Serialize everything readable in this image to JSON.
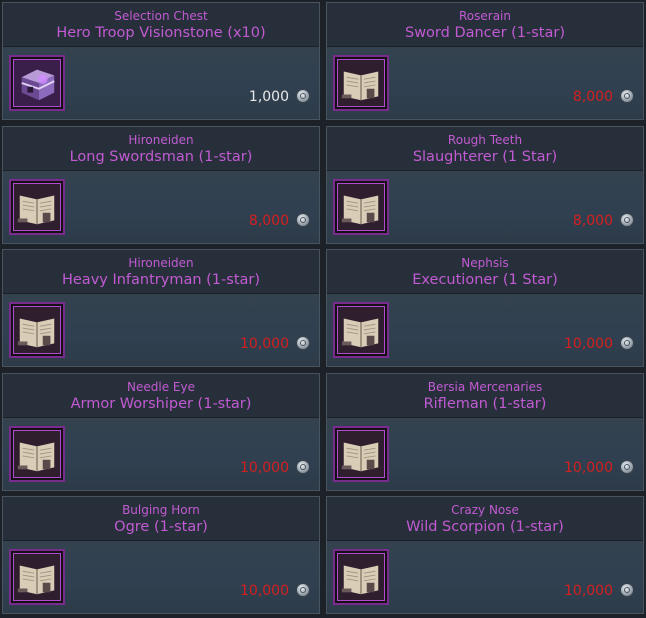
{
  "items": [
    {
      "subtitle": "Selection Chest",
      "title": "Hero Troop Visionstone (x10)",
      "icon": "chest-icon",
      "price": "1,000",
      "price_color": "white"
    },
    {
      "subtitle": "Roserain",
      "title": "Sword Dancer (1-star)",
      "icon": "book-icon",
      "price": "8,000",
      "price_color": "red"
    },
    {
      "subtitle": "Hironeiden",
      "title": "Long Swordsman (1-star)",
      "icon": "book-icon",
      "price": "8,000",
      "price_color": "red"
    },
    {
      "subtitle": "Rough Teeth",
      "title": "Slaughterer (1 Star)",
      "icon": "book-icon",
      "price": "8,000",
      "price_color": "red"
    },
    {
      "subtitle": "Hironeiden",
      "title": "Heavy Infantryman (1-star)",
      "icon": "book-icon",
      "price": "10,000",
      "price_color": "red"
    },
    {
      "subtitle": "Nephsis",
      "title": "Executioner (1 Star)",
      "icon": "book-icon",
      "price": "10,000",
      "price_color": "red"
    },
    {
      "subtitle": "Needle Eye",
      "title": "Armor Worshiper (1-star)",
      "icon": "book-icon",
      "price": "10,000",
      "price_color": "red"
    },
    {
      "subtitle": "Bersia Mercenaries",
      "title": "Rifleman (1-star)",
      "icon": "book-icon",
      "price": "10,000",
      "price_color": "red"
    },
    {
      "subtitle": "Bulging Horn",
      "title": "Ogre (1-star)",
      "icon": "book-icon",
      "price": "10,000",
      "price_color": "red"
    },
    {
      "subtitle": "Crazy Nose",
      "title": "Wild Scorpion (1-star)",
      "icon": "book-icon",
      "price": "10,000",
      "price_color": "red"
    }
  ],
  "colors": {
    "title": "#c25ad3",
    "price_red": "#d51f1f",
    "price_white": "#e8e8e8",
    "card_bg": "#2a3540"
  }
}
